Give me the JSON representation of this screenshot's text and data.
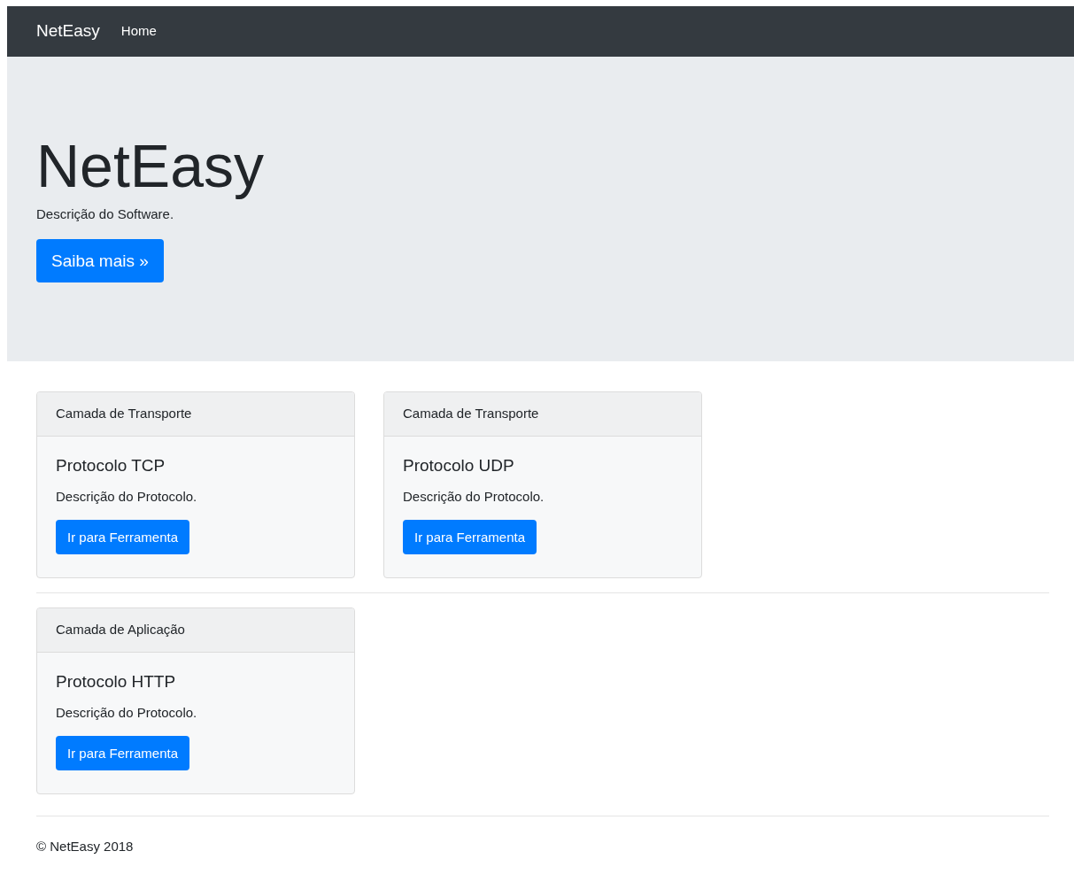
{
  "navbar": {
    "brand": "NetEasy",
    "links": [
      "Home"
    ]
  },
  "hero": {
    "title": "NetEasy",
    "description": "Descrição do Software.",
    "button": "Saiba mais »"
  },
  "sections": [
    {
      "cards": [
        {
          "header": "Camada de Transporte",
          "title": "Protocolo TCP",
          "text": "Descrição do Protocolo.",
          "button": "Ir para Ferramenta"
        },
        {
          "header": "Camada de Transporte",
          "title": "Protocolo UDP",
          "text": "Descrição do Protocolo.",
          "button": "Ir para Ferramenta"
        }
      ]
    },
    {
      "cards": [
        {
          "header": "Camada de Aplicação",
          "title": "Protocolo HTTP",
          "text": "Descrição do Protocolo.",
          "button": "Ir para Ferramenta"
        }
      ]
    }
  ],
  "footer": "© NetEasy 2018"
}
